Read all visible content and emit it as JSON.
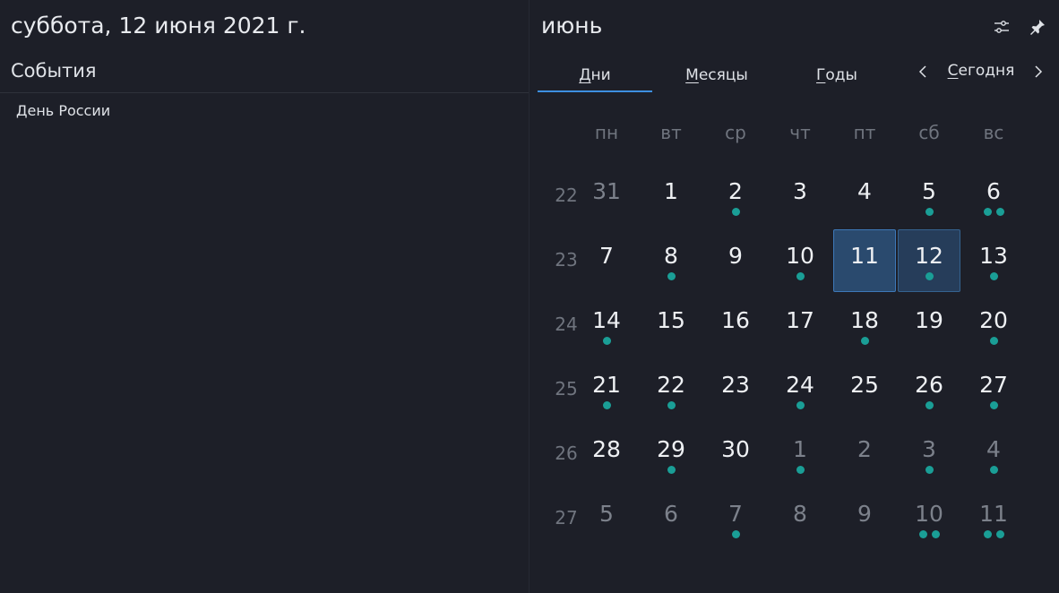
{
  "header": {
    "date_title": "суббота, 12 июня 2021 г.",
    "month_title": "июнь"
  },
  "events": {
    "heading": "События",
    "items": [
      "День России"
    ]
  },
  "tabs": [
    {
      "first": "",
      "under": "Д",
      "rest": "ни",
      "active": true
    },
    {
      "first": "",
      "under": "М",
      "rest": "есяцы",
      "active": false
    },
    {
      "first": "",
      "under": "Г",
      "rest": "оды",
      "active": false
    }
  ],
  "nav": {
    "today_under": "С",
    "today_rest": "егодня"
  },
  "colors": {
    "accent": "#3d8fe0",
    "event_dot": "#1a9e96",
    "today_bg": "#2a4a6e"
  },
  "calendar": {
    "weekdays": [
      "пн",
      "вт",
      "ср",
      "чт",
      "пт",
      "сб",
      "вс"
    ],
    "weeks": [
      {
        "num": "22",
        "days": [
          {
            "d": "31",
            "other": true,
            "dots": 0
          },
          {
            "d": "1",
            "dots": 0
          },
          {
            "d": "2",
            "dots": 1
          },
          {
            "d": "3",
            "dots": 0
          },
          {
            "d": "4",
            "dots": 0
          },
          {
            "d": "5",
            "dots": 1
          },
          {
            "d": "6",
            "dots": 2
          }
        ]
      },
      {
        "num": "23",
        "days": [
          {
            "d": "7",
            "dots": 0
          },
          {
            "d": "8",
            "dots": 1
          },
          {
            "d": "9",
            "dots": 0
          },
          {
            "d": "10",
            "dots": 1
          },
          {
            "d": "11",
            "dots": 0,
            "today": true
          },
          {
            "d": "12",
            "dots": 1,
            "selected": true
          },
          {
            "d": "13",
            "dots": 1
          }
        ]
      },
      {
        "num": "24",
        "days": [
          {
            "d": "14",
            "dots": 1
          },
          {
            "d": "15",
            "dots": 0
          },
          {
            "d": "16",
            "dots": 0
          },
          {
            "d": "17",
            "dots": 0
          },
          {
            "d": "18",
            "dots": 1
          },
          {
            "d": "19",
            "dots": 0
          },
          {
            "d": "20",
            "dots": 1
          }
        ]
      },
      {
        "num": "25",
        "days": [
          {
            "d": "21",
            "dots": 1
          },
          {
            "d": "22",
            "dots": 1
          },
          {
            "d": "23",
            "dots": 0
          },
          {
            "d": "24",
            "dots": 1
          },
          {
            "d": "25",
            "dots": 0
          },
          {
            "d": "26",
            "dots": 1
          },
          {
            "d": "27",
            "dots": 1
          }
        ]
      },
      {
        "num": "26",
        "days": [
          {
            "d": "28",
            "dots": 0
          },
          {
            "d": "29",
            "dots": 1
          },
          {
            "d": "30",
            "dots": 0
          },
          {
            "d": "1",
            "other": true,
            "dots": 1
          },
          {
            "d": "2",
            "other": true,
            "dots": 0
          },
          {
            "d": "3",
            "other": true,
            "dots": 1
          },
          {
            "d": "4",
            "other": true,
            "dots": 1
          }
        ]
      },
      {
        "num": "27",
        "days": [
          {
            "d": "5",
            "other": true,
            "dots": 0
          },
          {
            "d": "6",
            "other": true,
            "dots": 0
          },
          {
            "d": "7",
            "other": true,
            "dots": 1
          },
          {
            "d": "8",
            "other": true,
            "dots": 0
          },
          {
            "d": "9",
            "other": true,
            "dots": 0
          },
          {
            "d": "10",
            "other": true,
            "dots": 2
          },
          {
            "d": "11",
            "other": true,
            "dots": 2
          }
        ]
      }
    ]
  }
}
